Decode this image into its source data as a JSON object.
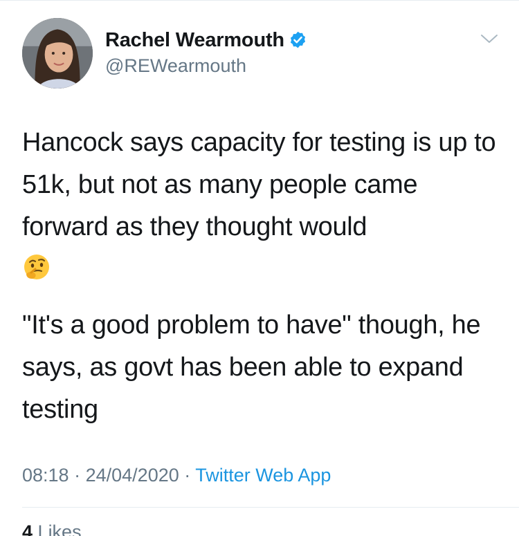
{
  "author": {
    "name": "Rachel Wearmouth",
    "handle": "@REWearmouth",
    "verified_color": "#1da1f2"
  },
  "tweet": {
    "paragraph_1": "Hancock says capacity for testing is up to 51k, but not as many people came forward as they thought would",
    "emoji": "thinking-face",
    "paragraph_2": "\"It's a good problem to have\" though, he says, as govt has been able to expand testing"
  },
  "meta": {
    "time": "08:18",
    "separator": "·",
    "date": "24/04/2020",
    "source": "Twitter Web App"
  },
  "stats": {
    "likes_count": "4",
    "likes_label": "Likes"
  },
  "colors": {
    "text": "#14171a",
    "secondary": "#657786",
    "link": "#1b95e0",
    "divider": "#e6ecf0"
  }
}
